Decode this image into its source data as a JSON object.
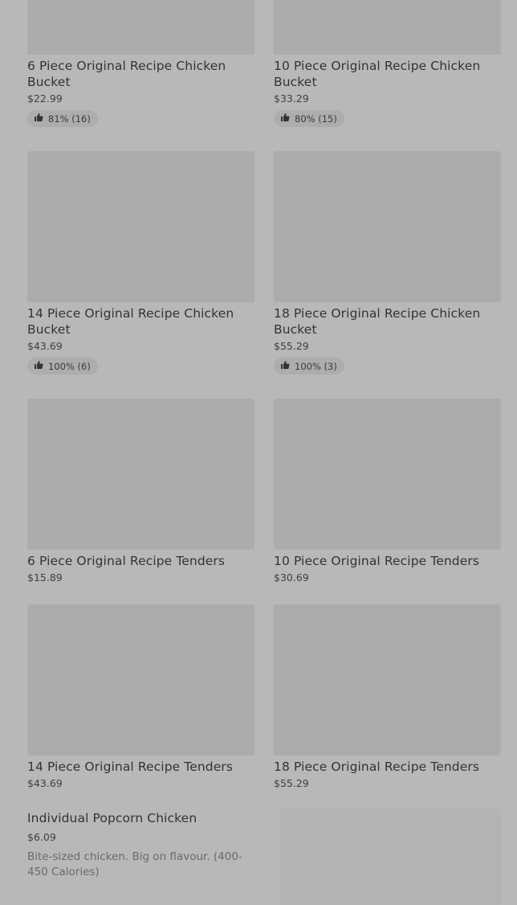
{
  "products": [
    {
      "title": "6 Piece Original Recipe Chicken Bucket",
      "price": "$22.99",
      "rating": "81% (16)"
    },
    {
      "title": "10 Piece Original Recipe Chicken Bucket",
      "price": "$33.29",
      "rating": "80% (15)"
    },
    {
      "title": "14 Piece Original Recipe Chicken Bucket",
      "price": "$43.69",
      "rating": "100% (6)"
    },
    {
      "title": "18 Piece Original Recipe Chicken Bucket",
      "price": "$55.29",
      "rating": "100% (3)"
    },
    {
      "title": "6 Piece Original Recipe Tenders",
      "price": "$15.89"
    },
    {
      "title": "10 Piece Original Recipe Tenders",
      "price": "$30.69"
    },
    {
      "title": "14 Piece Original Recipe Tenders",
      "price": "$43.69"
    },
    {
      "title": "18 Piece Original Recipe Tenders",
      "price": "$55.29"
    }
  ],
  "popcorn": {
    "title": "Individual Popcorn Chicken",
    "price": "$6.09",
    "description": "Bite-sized chicken. Big on flavour. (400-450 Calories)"
  },
  "icons": {
    "rating": "thumbs-up-icon"
  },
  "colors": {
    "background": "#b8b8b8",
    "image_placeholder": "#acacac"
  }
}
